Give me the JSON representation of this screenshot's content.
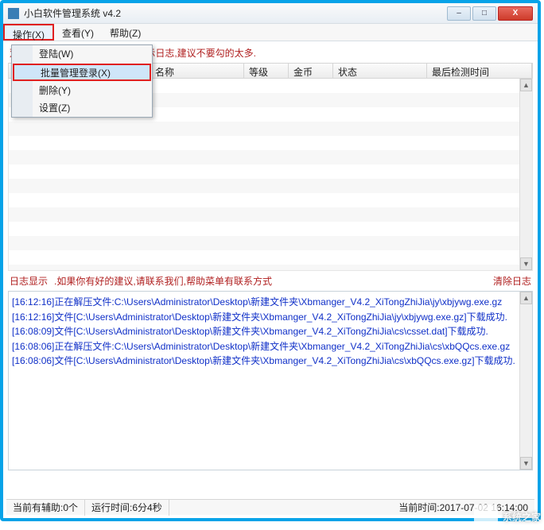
{
  "window": {
    "title": "小白软件管理系统  v4.2",
    "min": "–",
    "max": "□",
    "close": "X"
  },
  "menu": {
    "operate": "操作(X)",
    "view": "查看(Y)",
    "help": "帮助(Z)"
  },
  "dropdown": {
    "login": "登陆(W)",
    "batch": "批量管理登录(X)",
    "delete": "删除(Y)",
    "settings": "设置(Z)"
  },
  "hint": "双击显示界面,前面勾起来实时显示日志,建议不要勾的太多.",
  "columns": {
    "c1": "",
    "c2": "名称",
    "c3": "等级",
    "c4": "金币",
    "c5": "状态",
    "c6": "最后检测时间"
  },
  "logbar": {
    "label": "日志显示",
    "msg": ".如果你有好的建议,请联系我们,帮助菜单有联系方式",
    "clear": "清除日志"
  },
  "log": {
    "l1": "[16:12:16]正在解压文件:C:\\Users\\Administrator\\Desktop\\新建文件夹\\Xbmanger_V4.2_XiTongZhiJia\\jy\\xbjywg.exe.gz",
    "l2": "[16:12:16]文件[C:\\Users\\Administrator\\Desktop\\新建文件夹\\Xbmanger_V4.2_XiTongZhiJia\\jy\\xbjywg.exe.gz]下载成功.",
    "l3": "[16:08:09]文件[C:\\Users\\Administrator\\Desktop\\新建文件夹\\Xbmanger_V4.2_XiTongZhiJia\\cs\\csset.dat]下载成功.",
    "l4": "[16:08:06]正在解压文件:C:\\Users\\Administrator\\Desktop\\新建文件夹\\Xbmanger_V4.2_XiTongZhiJia\\cs\\xbQQcs.exe.gz",
    "l5": "[16:08:06]文件[C:\\Users\\Administrator\\Desktop\\新建文件夹\\Xbmanger_V4.2_XiTongZhiJia\\cs\\xbQQcs.exe.gz]下载成功."
  },
  "status": {
    "left": "当前有辅助:0个",
    "mid": "运行时间:6分4秒",
    "right": "当前时间:2017-07-02 16:14:00"
  },
  "watermark": "系统之家"
}
